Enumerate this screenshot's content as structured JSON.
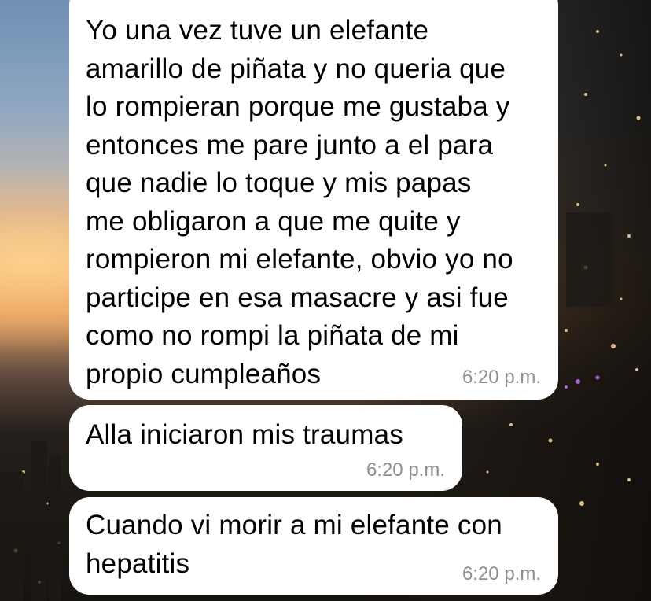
{
  "messages": [
    {
      "text": "Yo una vez tuve un elefante\namarillo de piñata y no queria que\nlo rompieran porque me gustaba y\nentonces me pare junto a el para\nque nadie lo toque y mis papas\nme obligaron a que me quite y\nrompieron mi elefante, obvio yo no\nparticipe en esa masacre y asi fue\ncomo no rompi la piñata de mi\npropio cumpleaños",
      "time": "6:20 p.m."
    },
    {
      "text": "Alla iniciaron mis traumas",
      "time": "6:20 p.m."
    },
    {
      "text": "Cuando vi morir a mi elefante con\nhepatitis",
      "time": "6:20 p.m."
    }
  ],
  "colors": {
    "bubble": "#ffffff",
    "timestamp": "#8e8e93",
    "text": "#000000"
  }
}
